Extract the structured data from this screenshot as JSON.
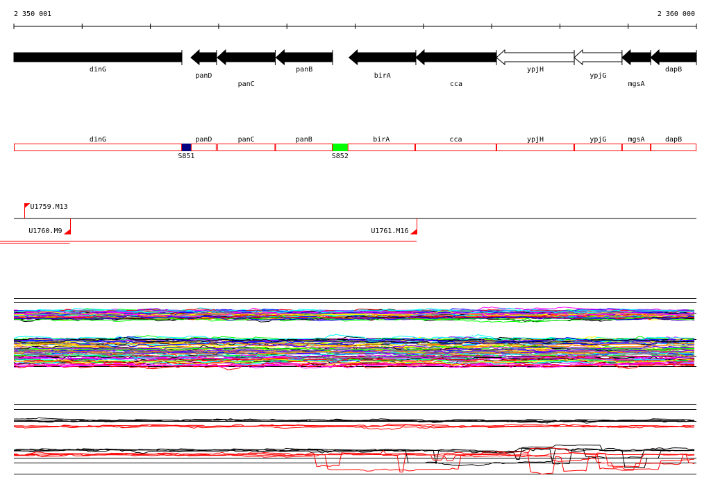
{
  "scale": {
    "start_label": "2 350 001",
    "end_label": "2 360 000",
    "start": 2350001,
    "end": 2360000
  },
  "genes": [
    {
      "name": "dinG",
      "start": 2350001,
      "end": 2352462,
      "strand": "+",
      "fill": "#000000"
    },
    {
      "name": "panD",
      "start": 2352594,
      "end": 2352970,
      "strand": "-",
      "fill": "#000000"
    },
    {
      "name": "panC",
      "start": 2352980,
      "end": 2353830,
      "strand": "-",
      "fill": "#000000"
    },
    {
      "name": "panB",
      "start": 2353840,
      "end": 2354670,
      "strand": "-",
      "fill": "#000000"
    },
    {
      "name": "birA",
      "start": 2354910,
      "end": 2355890,
      "strand": "-",
      "fill": "#000000"
    },
    {
      "name": "cca",
      "start": 2355890,
      "end": 2357070,
      "strand": "-",
      "fill": "#000000"
    },
    {
      "name": "ypjH",
      "start": 2357070,
      "end": 2358210,
      "strand": "-",
      "fill": "#ffffff"
    },
    {
      "name": "ypjG",
      "start": 2358210,
      "end": 2358910,
      "strand": "-",
      "fill": "#ffffff"
    },
    {
      "name": "mgsA",
      "start": 2358910,
      "end": 2359330,
      "strand": "-",
      "fill": "#000000"
    },
    {
      "name": "dapB",
      "start": 2359330,
      "end": 2360000,
      "strand": "-",
      "fill": "#000000"
    }
  ],
  "segments": [
    {
      "name": "dinG",
      "start": 2350001,
      "end": 2352462
    },
    {
      "name": "panD",
      "start": 2352594,
      "end": 2352970
    },
    {
      "name": "panC",
      "start": 2352980,
      "end": 2353830
    },
    {
      "name": "panB",
      "start": 2353830,
      "end": 2354670
    },
    {
      "name": "birA",
      "start": 2354890,
      "end": 2355880
    },
    {
      "name": "cca",
      "start": 2355880,
      "end": 2357070
    },
    {
      "name": "ypjH",
      "start": 2357070,
      "end": 2358210
    },
    {
      "name": "ypjG",
      "start": 2358210,
      "end": 2358910
    },
    {
      "name": "mgsA",
      "start": 2358910,
      "end": 2359330
    },
    {
      "name": "dapB",
      "start": 2359330,
      "end": 2360000
    }
  ],
  "spacers": [
    {
      "name": "S851",
      "start": 2352462,
      "end": 2352594,
      "color": "#000080"
    },
    {
      "name": "S852",
      "start": 2354670,
      "end": 2354890,
      "color": "#00ff00"
    }
  ],
  "markers": [
    {
      "name": "U1759.M13",
      "pos": 2350150,
      "strand": "+"
    },
    {
      "name": "U1760.M9",
      "pos": 2350820,
      "strand": "-"
    },
    {
      "name": "U1761.M16",
      "pos": 2355900,
      "strand": "-"
    }
  ],
  "colors": {
    "segment_border": "#ff0000",
    "marker": "#ff0000",
    "axis": "#000000"
  },
  "series_palette": [
    "#ff00ff",
    "#00ffff",
    "#ff0000",
    "#00ff00",
    "#0000ff",
    "#ffff00",
    "#ff8000",
    "#808080",
    "#000000",
    "#8000ff"
  ],
  "plot_pair_colors": [
    "#000000",
    "#ff0000"
  ]
}
